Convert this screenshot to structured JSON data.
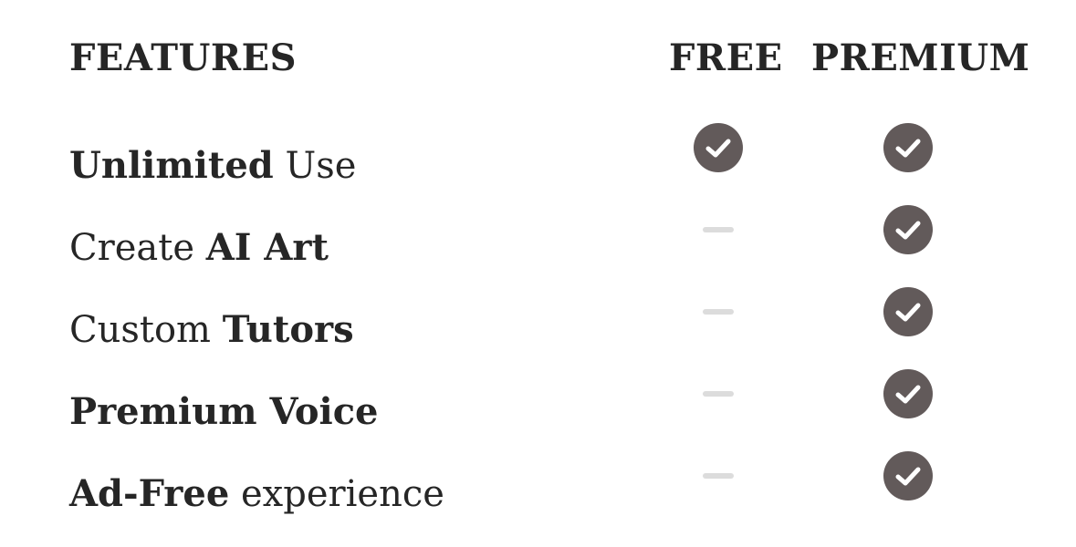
{
  "header": {
    "features": "FEATURES",
    "free": "FREE",
    "premium": "PREMIUM"
  },
  "rows": [
    {
      "bold_part": "Unlimited",
      "regular_part": " Use",
      "free": "check",
      "premium": "check"
    },
    {
      "regular_part": "Create ",
      "bold_part": "AI Art",
      "free": "none",
      "premium": "check"
    },
    {
      "regular_part": "Custom ",
      "bold_part": "Tutors",
      "free": "none",
      "premium": "check"
    },
    {
      "bold_part": "Premium Voice",
      "free": "none",
      "premium": "check"
    },
    {
      "bold_part": "Ad-Free",
      "regular_part": " experience",
      "free": "none",
      "premium": "check"
    }
  ],
  "icons": {
    "included": "check-circle-icon",
    "not_included": "dash-icon"
  },
  "colors": {
    "check_bg": "#625a5a",
    "dash": "#dcdcdc",
    "text": "#262626"
  }
}
